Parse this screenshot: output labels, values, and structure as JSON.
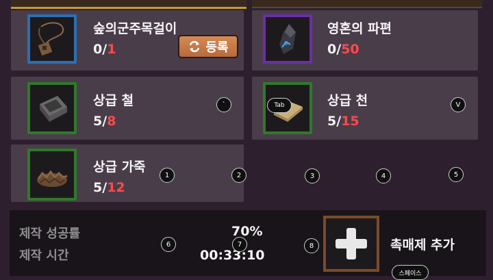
{
  "materials": [
    {
      "name": "숲의군주목걸이",
      "have": "0",
      "need": "1",
      "icon": "necklace-icon",
      "rarity_color": "#2d6fb3"
    },
    {
      "name": "영혼의 파편",
      "have": "0",
      "need": "50",
      "icon": "soul-shard-icon",
      "rarity_color": "#6b2fa6"
    },
    {
      "name": "상급 철",
      "have": "5",
      "need": "8",
      "icon": "iron-ingot-icon",
      "rarity_color": "#2e7a2a"
    },
    {
      "name": "상급 천",
      "have": "5",
      "need": "15",
      "icon": "cloth-icon",
      "rarity_color": "#2e7a2a"
    },
    {
      "name": "상급 가죽",
      "have": "5",
      "need": "12",
      "icon": "leather-icon",
      "rarity_color": "#2e7a2a"
    }
  ],
  "register_button": {
    "label": "등록",
    "icon": "refresh-icon"
  },
  "stats": {
    "success_label": "제작 성공률",
    "success_value": "70%",
    "time_label": "제작 시간",
    "time_value": "00:33:10"
  },
  "catalyst": {
    "label": "촉매제 추가",
    "icon": "plus-icon"
  },
  "key_hints": [
    "`",
    "Tab",
    "V",
    "1",
    "2",
    "3",
    "4",
    "5",
    "6",
    "7",
    "8",
    "스페이스"
  ],
  "colors": {
    "need_red": "#ff4a4a",
    "panel_bg": "#4a3d4a",
    "accent_gold": "#c79a2d"
  }
}
